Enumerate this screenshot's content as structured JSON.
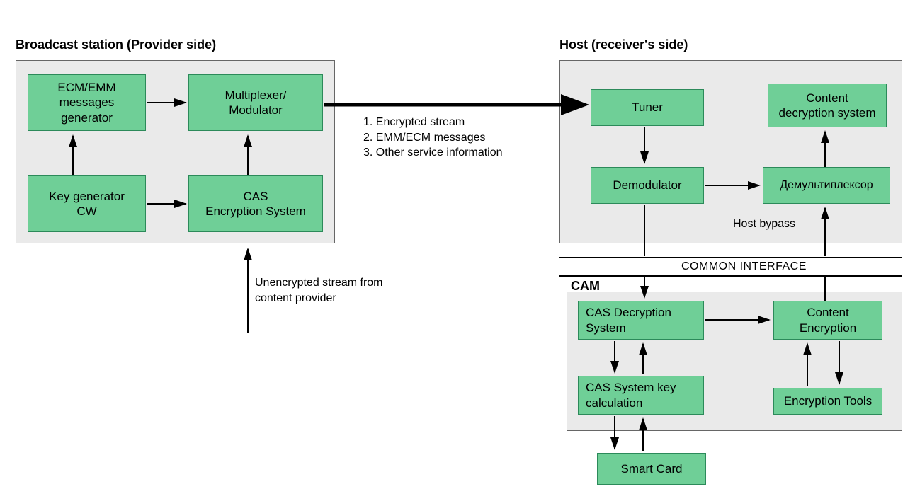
{
  "titles": {
    "provider": "Broadcast station (Provider side)",
    "host": "Host (receiver's side)",
    "cam": "CAM"
  },
  "provider": {
    "ecm_emm": "ECM/EMM\nmessages\ngenerator",
    "multiplexer": "Multiplexer/\nModulator",
    "key_gen": "Key generator\nCW",
    "cas_enc": "CAS\nEncryption System"
  },
  "stream_label": "1. Encrypted stream\n2. EMM/ECM messages\n3. Other service information",
  "unencrypted_label": "Unencrypted stream from\ncontent provider",
  "host": {
    "tuner": "Tuner",
    "demod": "Demodulator",
    "demux": "Демультиплексор",
    "content_dec": "Content\ndecryption system",
    "bypass": "Host bypass"
  },
  "common_interface": "COMMON INTERFACE",
  "cam": {
    "cas_dec": "CAS  Decryption\nSystem",
    "content_enc": "Content\nEncryption",
    "key_calc": "CAS  System key\ncalculation",
    "enc_tools": "Encryption Tools",
    "smart_card": "Smart Card"
  }
}
